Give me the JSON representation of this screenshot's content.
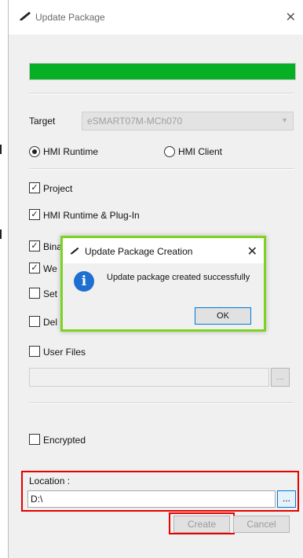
{
  "window": {
    "title": "Update Package",
    "close_symbol": "✕",
    "title_icon": "pen-icon"
  },
  "progress": {
    "value": 1.0,
    "color": "#06b025"
  },
  "target": {
    "label": "Target",
    "value": "eSMART07M-MCh070"
  },
  "mode": {
    "options": [
      {
        "label": "HMI Runtime",
        "selected": true
      },
      {
        "label": "HMI Client",
        "selected": false
      }
    ]
  },
  "options": {
    "project": {
      "label": "Project",
      "checked": true
    },
    "runtime_plugin": {
      "label": "HMI Runtime & Plug-In",
      "checked": true
    },
    "binaries_partial": {
      "label": "Bina",
      "checked": true
    },
    "web_partial": {
      "label": "We",
      "checked": true
    },
    "set_partial": {
      "label": "Set",
      "checked": false
    },
    "delete_partial": {
      "label": "Del",
      "checked": false
    },
    "user_files": {
      "label": "User Files",
      "checked": false
    },
    "user_files_browse": "..."
  },
  "encrypted": {
    "label": "Encrypted",
    "checked": false
  },
  "location": {
    "label": "Location :",
    "value": "D:\\",
    "browse_label": "..."
  },
  "buttons": {
    "create": "Create",
    "cancel": "Cancel"
  },
  "dialog": {
    "title": "Update Package Creation",
    "close_symbol": "✕",
    "message": "Update package created successfully",
    "ok": "OK",
    "icon": "info-icon",
    "border_color": "#7ed321"
  },
  "highlight_color": "#e60000"
}
